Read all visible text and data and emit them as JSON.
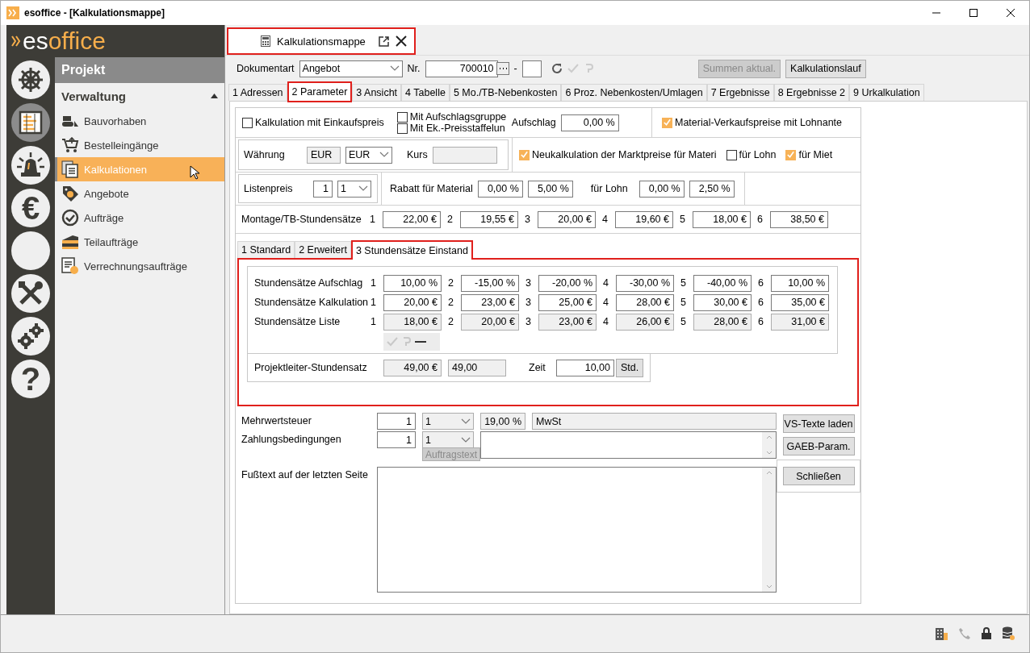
{
  "window": {
    "title": "esoffice - [Kalkulationsmappe]"
  },
  "logo": {
    "part1": "es",
    "part2": "office"
  },
  "rail": [
    {
      "kind": "wheel",
      "selected": false
    },
    {
      "kind": "board",
      "selected": true
    },
    {
      "kind": "alarm",
      "selected": false
    },
    {
      "kind": "glyph",
      "glyph": "€",
      "selected": false
    },
    {
      "kind": "blank",
      "selected": false
    },
    {
      "kind": "tools",
      "selected": false
    },
    {
      "kind": "gears",
      "selected": false
    },
    {
      "kind": "glyph",
      "glyph": "?",
      "selected": false
    }
  ],
  "sidebar": {
    "title": "Projekt",
    "section": {
      "label": "Verwaltung",
      "expanded": true
    },
    "items": [
      {
        "kind": "bulldozer",
        "label": "Bauvorhaben",
        "selected": false
      },
      {
        "kind": "cart",
        "label": "Bestelleingänge",
        "selected": false
      },
      {
        "kind": "documents",
        "label": "Kalkulationen",
        "selected": true
      },
      {
        "kind": "tag",
        "label": "Angebote",
        "selected": false
      },
      {
        "kind": "check",
        "label": "Aufträge",
        "selected": false
      },
      {
        "kind": "slice",
        "label": "Teilaufträge",
        "selected": false
      },
      {
        "kind": "ledger",
        "label": "Verrechnungsaufträge",
        "selected": false
      }
    ]
  },
  "document_tab": {
    "label": "Kalkulationsmappe",
    "highlighted": true
  },
  "toolbar": {
    "type_label": "Dokumentart",
    "type_value": "Angebot",
    "nr_label": "Nr.",
    "nr_value": "700010",
    "nr_separator": "-",
    "buttons": [
      {
        "label": "Summen aktual.",
        "disabled": true
      },
      {
        "label": "Kalkulationslauf",
        "disabled": false
      }
    ]
  },
  "tabs": [
    {
      "label": "1 Adressen",
      "selected": false,
      "highlighted": false
    },
    {
      "label": "2 Parameter",
      "selected": true,
      "highlighted": true
    },
    {
      "label": "3 Ansicht",
      "selected": false,
      "highlighted": false
    },
    {
      "label": "4 Tabelle",
      "selected": false,
      "highlighted": false
    },
    {
      "label": "5 Mo./TB-Nebenkosten",
      "selected": false,
      "highlighted": false
    },
    {
      "label": "6 Proz. Nebenkosten/Umlagen",
      "selected": false,
      "highlighted": false
    },
    {
      "label": "7 Ergebnisse",
      "selected": false,
      "highlighted": false
    },
    {
      "label": "8 Ergebnisse 2",
      "selected": false,
      "highlighted": false
    },
    {
      "label": "9 Urkalkulation",
      "selected": false,
      "highlighted": false
    }
  ],
  "parameters": {
    "einkaufspreis": {
      "label": "Kalkulation mit Einkaufspreis",
      "checked": false
    },
    "aufschlagsgruppen": {
      "label": "Mit Aufschlagsgruppe",
      "checked": false
    },
    "preisstaffelung": {
      "label": "Mit Ek.-Preisstaffelun",
      "checked": false
    },
    "aufschlag": {
      "label": "Aufschlag",
      "value": "0,00 %"
    },
    "lohnanteil": {
      "label": "Material-Verkaufspreise mit Lohnante",
      "checked": true
    },
    "waehrung": {
      "label": "Währung",
      "code": "EUR",
      "combo": "EUR",
      "kurs_label": "Kurs"
    },
    "neukalkulation": {
      "label": "Neukalkulation der Marktpreise für Materi",
      "checked": true
    },
    "fuer_lohn": {
      "label": "für Lohn",
      "checked": false
    },
    "fuer_miete": {
      "label": "für Miet",
      "checked": true
    },
    "listenpreis": {
      "label": "Listenpreis",
      "value": "1",
      "combo": "1"
    },
    "rabatt": {
      "material_label": "Rabatt für Material",
      "material": [
        "0,00 %",
        "5,00 %"
      ],
      "lohn_label": "für Lohn",
      "lohn": [
        "0,00 %",
        "2,50 %"
      ]
    },
    "montage": {
      "label": "Montage/TB-Stundensätze",
      "cells": [
        {
          "index": "1",
          "value": "22,00 €"
        },
        {
          "index": "2",
          "value": "19,55 €"
        },
        {
          "index": "3",
          "value": "20,00 €"
        },
        {
          "index": "4",
          "value": "19,60 €"
        },
        {
          "index": "5",
          "value": "18,00 €"
        },
        {
          "index": "6",
          "value": "38,50 €"
        }
      ]
    }
  },
  "subtabs": [
    {
      "label": "1 Standard",
      "selected": false,
      "highlighted": false
    },
    {
      "label": "2 Erweitert",
      "selected": false,
      "highlighted": false
    },
    {
      "label": "3 Stundensätze Einstand",
      "selected": true,
      "highlighted": true
    }
  ],
  "hourly_rates": {
    "highlighted": true,
    "rows": [
      {
        "label": "Stundensätze Aufschlag",
        "readonly": false,
        "cells": [
          {
            "index": "1",
            "value": "10,00 %"
          },
          {
            "index": "2",
            "value": "-15,00 %"
          },
          {
            "index": "3",
            "value": "-20,00 %"
          },
          {
            "index": "4",
            "value": "-30,00 %"
          },
          {
            "index": "5",
            "value": "-40,00 %"
          },
          {
            "index": "6",
            "value": "10,00 %"
          }
        ]
      },
      {
        "label": "Stundensätze Kalkulation",
        "readonly": false,
        "cells": [
          {
            "index": "1",
            "value": "20,00 €"
          },
          {
            "index": "2",
            "value": "23,00 €"
          },
          {
            "index": "3",
            "value": "25,00 €"
          },
          {
            "index": "4",
            "value": "28,00 €"
          },
          {
            "index": "5",
            "value": "30,00 €"
          },
          {
            "index": "6",
            "value": "35,00 €"
          }
        ]
      },
      {
        "label": "Stundensätze Liste",
        "readonly": true,
        "cells": [
          {
            "index": "1",
            "value": "18,00 €"
          },
          {
            "index": "2",
            "value": "20,00 €"
          },
          {
            "index": "3",
            "value": "23,00 €"
          },
          {
            "index": "4",
            "value": "26,00 €"
          },
          {
            "index": "5",
            "value": "28,00 €"
          },
          {
            "index": "6",
            "value": "31,00 €"
          }
        ]
      }
    ]
  },
  "project_lead": {
    "label": "Projektleiter-Stundensatz",
    "value": "49,00 €",
    "plain": "49,00",
    "time_label": "Zeit",
    "time": "10,00",
    "unit": "Std."
  },
  "vat": {
    "label": "Mehrwertsteuer",
    "code": "1",
    "combo": "1",
    "rate": "19,00 %",
    "name": "MwSt"
  },
  "payment": {
    "label": "Zahlungsbedingungen",
    "code": "1",
    "combo": "1",
    "button": "Auftragstext"
  },
  "footer_text": {
    "label": "Fußtext auf der letzten Seite"
  },
  "side_buttons": [
    {
      "label": "VS-Texte laden"
    },
    {
      "label": "GAEB-Param."
    },
    {
      "label": "Schließen"
    }
  ]
}
